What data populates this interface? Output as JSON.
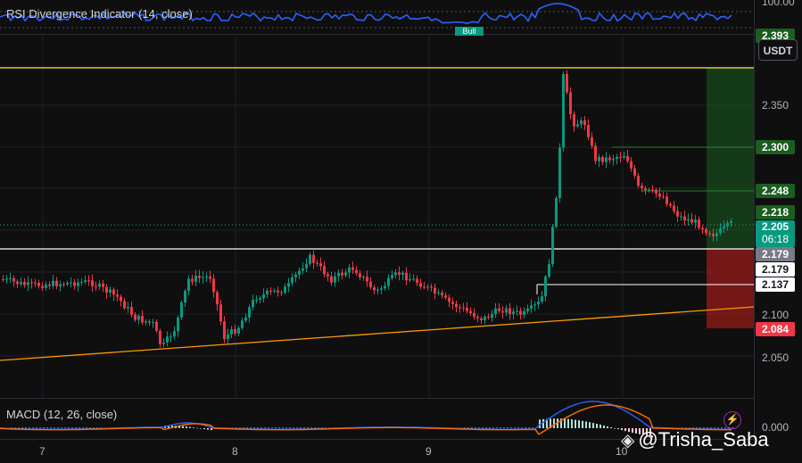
{
  "rsi": {
    "legend": "RSI Divergence Indicator (14, close)",
    "scale_label": "100.00",
    "badge": "Bull",
    "color": "#2962ff"
  },
  "macd": {
    "legend": "MACD (12, 26, close)",
    "scale_label": "0.000",
    "macd_color": "#2962ff",
    "signal_color": "#ff6d00"
  },
  "price_scale": {
    "currency": "USDT",
    "ticks": [
      "2.350",
      "2.100",
      "2.050"
    ],
    "tags": {
      "tp": "2.393",
      "t2": "2.300",
      "t3": "2.248",
      "t4": "2.218",
      "last": "2.205",
      "countdown": "06:18",
      "entry": "2.179",
      "white1": "2.179",
      "white2": "2.137",
      "sl": "2.084"
    }
  },
  "time_axis": {
    "labels": [
      "7",
      "8",
      "9",
      "10"
    ]
  },
  "watermark": {
    "text": "@Trisha_Saba"
  },
  "colors": {
    "up": "#089981",
    "down": "#f23645",
    "trend": "#ff9800",
    "target_line": "#ffeb3b",
    "profit_zone": "#1b5e20",
    "loss_zone": "#b71c1c"
  }
}
